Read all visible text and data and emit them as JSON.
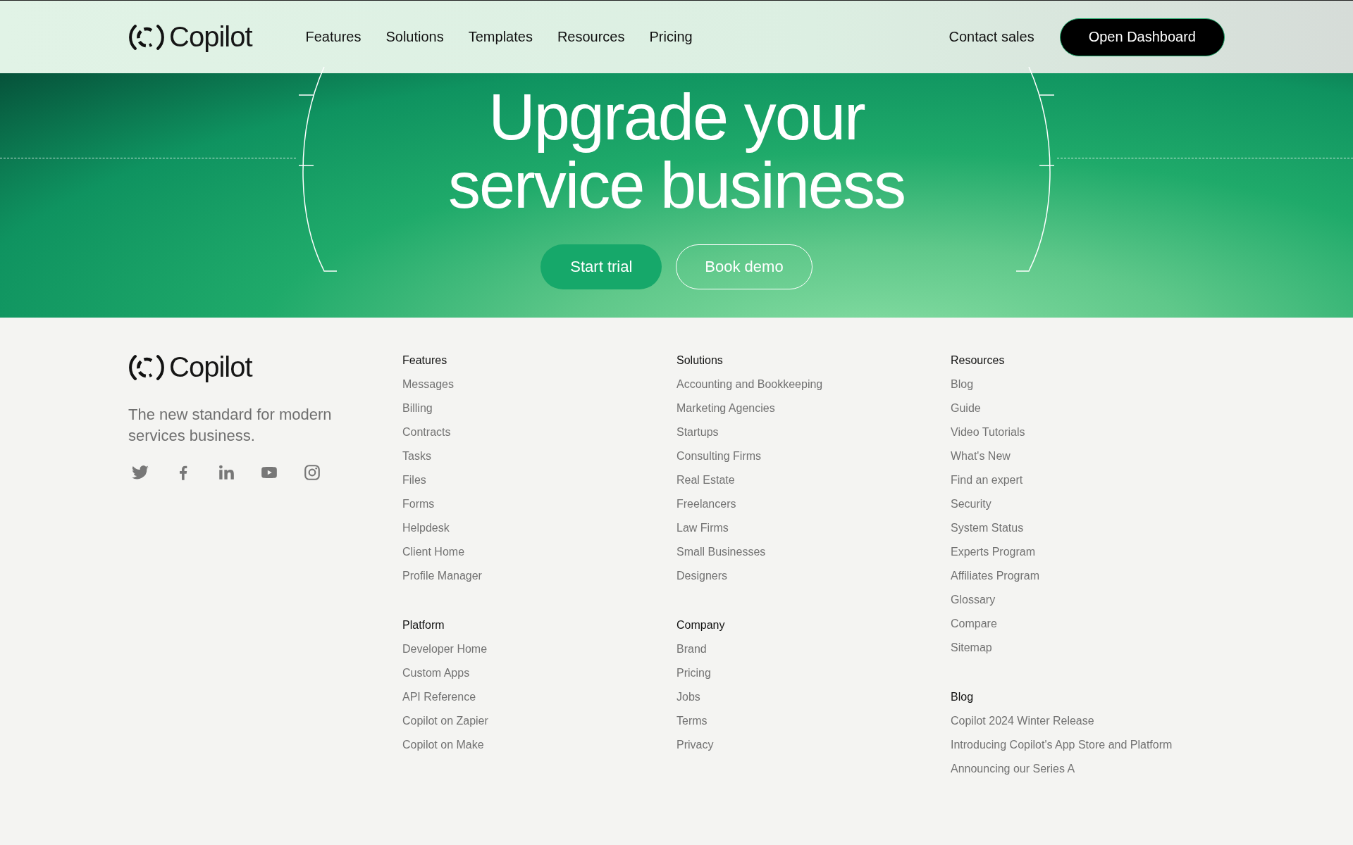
{
  "header": {
    "logo": "Copilot",
    "nav": [
      "Features",
      "Solutions",
      "Templates",
      "Resources",
      "Pricing"
    ],
    "contact": "Contact sales",
    "cta": "Open Dashboard"
  },
  "hero": {
    "title_lines": [
      "Upgrade your",
      "service business"
    ],
    "primary_button": "Start trial",
    "secondary_button": "Book demo"
  },
  "footer": {
    "logo": "Copilot",
    "tagline": "The new standard for modern services business.",
    "columns": [
      {
        "sections": [
          {
            "heading": "Features",
            "links": [
              "Messages",
              "Billing",
              "Contracts",
              "Tasks",
              "Files",
              "Forms",
              "Helpdesk",
              "Client Home",
              "Profile Manager"
            ]
          },
          {
            "heading": "Platform",
            "links": [
              "Developer Home",
              "Custom Apps",
              "API Reference",
              "Copilot on Zapier",
              "Copilot on Make"
            ]
          }
        ]
      },
      {
        "sections": [
          {
            "heading": "Solutions",
            "links": [
              "Accounting and Bookkeeping",
              "Marketing Agencies",
              "Startups",
              "Consulting Firms",
              "Real Estate",
              "Freelancers",
              "Law Firms",
              "Small Businesses",
              "Designers"
            ]
          },
          {
            "heading": "Company",
            "links": [
              "Brand",
              "Pricing",
              "Jobs",
              "Terms",
              "Privacy"
            ]
          }
        ]
      },
      {
        "sections": [
          {
            "heading": "Resources",
            "links": [
              "Blog",
              "Guide",
              "Video Tutorials",
              "What's New",
              "Find an expert",
              "Security",
              "System Status",
              "Experts Program",
              "Affiliates Program",
              "Glossary",
              "Compare",
              "Sitemap"
            ]
          },
          {
            "heading": "Blog",
            "links": [
              "Copilot 2024 Winter Release",
              "Introducing Copilot's App Store and Platform",
              "Announcing our Series A"
            ]
          }
        ]
      }
    ]
  }
}
